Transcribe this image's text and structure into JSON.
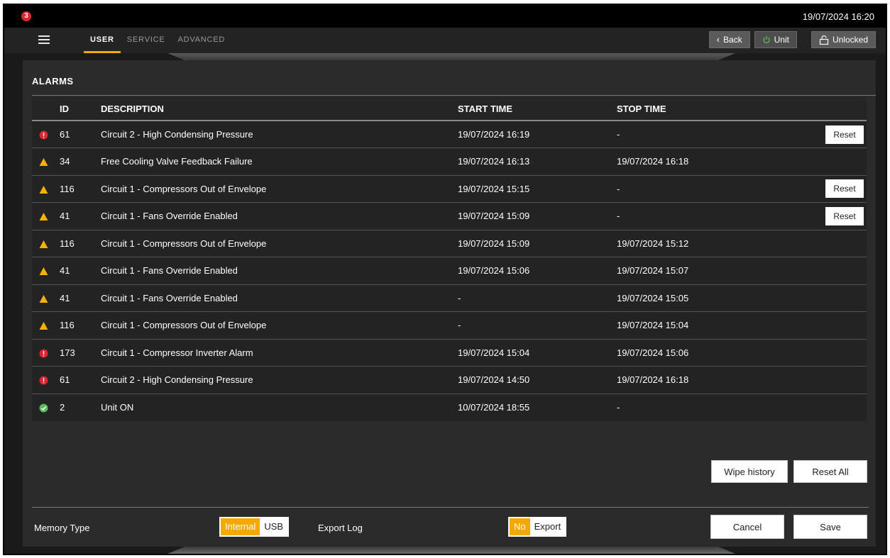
{
  "topbar": {
    "notification_count": "3",
    "datetime": "19/07/2024 16:20"
  },
  "nav": {
    "tabs": [
      "USER",
      "SERVICE",
      "ADVANCED"
    ],
    "back_label": "Back",
    "unit_label": "Unit",
    "lock_label": "Unlocked"
  },
  "panel": {
    "title": "ALARMS",
    "columns": {
      "id": "ID",
      "description": "DESCRIPTION",
      "start": "START TIME",
      "stop": "STOP TIME"
    }
  },
  "alarms": [
    {
      "type": "error",
      "id": "61",
      "description": "Circuit 2 - High Condensing Pressure",
      "start": "19/07/2024 16:19",
      "stop": "-",
      "action": "Reset"
    },
    {
      "type": "warning",
      "id": "34",
      "description": "Free Cooling Valve Feedback Failure",
      "start": "19/07/2024 16:13",
      "stop": "19/07/2024 16:18",
      "action": ""
    },
    {
      "type": "warning",
      "id": "116",
      "description": "Circuit 1 - Compressors Out of Envelope",
      "start": "19/07/2024 15:15",
      "stop": "-",
      "action": "Reset"
    },
    {
      "type": "warning",
      "id": "41",
      "description": "Circuit 1 - Fans Override Enabled",
      "start": "19/07/2024 15:09",
      "stop": "-",
      "action": "Reset"
    },
    {
      "type": "warning",
      "id": "116",
      "description": "Circuit 1 - Compressors Out of Envelope",
      "start": "19/07/2024 15:09",
      "stop": "19/07/2024 15:12",
      "action": ""
    },
    {
      "type": "warning",
      "id": "41",
      "description": "Circuit 1 - Fans Override Enabled",
      "start": "19/07/2024 15:06",
      "stop": "19/07/2024 15:07",
      "action": ""
    },
    {
      "type": "warning",
      "id": "41",
      "description": "Circuit 1 - Fans Override Enabled",
      "start": "-",
      "stop": "19/07/2024 15:05",
      "action": ""
    },
    {
      "type": "warning",
      "id": "116",
      "description": "Circuit 1 - Compressors Out of Envelope",
      "start": "-",
      "stop": "19/07/2024 15:04",
      "action": ""
    },
    {
      "type": "error",
      "id": "173",
      "description": "Circuit 1 - Compressor Inverter Alarm",
      "start": "19/07/2024 15:04",
      "stop": "19/07/2024 15:06",
      "action": ""
    },
    {
      "type": "error",
      "id": "61",
      "description": "Circuit 2 - High Condensing Pressure",
      "start": "19/07/2024 14:50",
      "stop": "19/07/2024 16:18",
      "action": ""
    },
    {
      "type": "ok",
      "id": "2",
      "description": "Unit ON",
      "start": "10/07/2024 18:55",
      "stop": "-",
      "action": ""
    }
  ],
  "actions": {
    "wipe_history": "Wipe history",
    "reset_all": "Reset All",
    "cancel": "Cancel",
    "save": "Save"
  },
  "footer": {
    "memory_label": "Memory Type",
    "memory_options": [
      "Internal",
      "USB"
    ],
    "memory_selected": "Internal",
    "export_label": "Export Log",
    "export_options": [
      "No",
      "Export"
    ],
    "export_selected": "No"
  },
  "colors": {
    "accent": "#f5a800",
    "error": "#d7282f",
    "warning": "#f5b100",
    "ok": "#5cb85c"
  }
}
